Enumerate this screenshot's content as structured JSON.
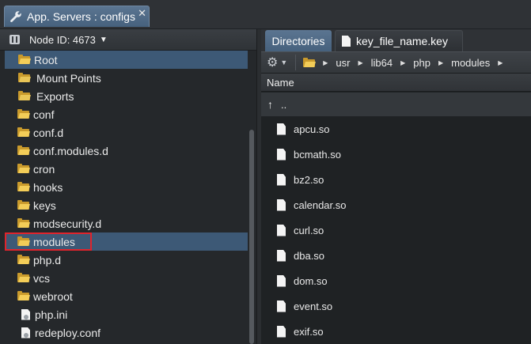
{
  "window": {
    "tab_title": "App. Servers : configs",
    "close_glyph": "✕"
  },
  "left": {
    "node_label": "Node ID: 4673",
    "tree": [
      {
        "label": "Root",
        "icon": "open-folder-icon",
        "selected": true
      },
      {
        "label": "Mount Points",
        "icon": "mount-folder-icon"
      },
      {
        "label": "Exports",
        "icon": "export-folder-icon"
      },
      {
        "label": "conf",
        "icon": "folder-icon"
      },
      {
        "label": "conf.d",
        "icon": "folder-icon"
      },
      {
        "label": "conf.modules.d",
        "icon": "folder-icon"
      },
      {
        "label": "cron",
        "icon": "folder-icon"
      },
      {
        "label": "hooks",
        "icon": "folder-icon"
      },
      {
        "label": "keys",
        "icon": "folder-icon"
      },
      {
        "label": "modsecurity.d",
        "icon": "folder-icon"
      },
      {
        "label": "modules",
        "icon": "folder-icon",
        "selected": true,
        "highlighted": true
      },
      {
        "label": "php.d",
        "icon": "folder-icon"
      },
      {
        "label": "vcs",
        "icon": "folder-icon"
      },
      {
        "label": "webroot",
        "icon": "folder-icon"
      },
      {
        "label": "php.ini",
        "icon": "config-file-icon"
      },
      {
        "label": "redeploy.conf",
        "icon": "config-file-icon"
      }
    ]
  },
  "right": {
    "tabs": [
      {
        "label": "Directories",
        "active": true
      },
      {
        "label": "key_file_name.key",
        "active": false
      }
    ],
    "breadcrumb": [
      "usr",
      "lib64",
      "php",
      "modules"
    ],
    "column_header": "Name",
    "parent_row": {
      "arrow": "↑",
      "label": ".."
    },
    "files": [
      "apcu.so",
      "bcmath.so",
      "bz2.so",
      "calendar.so",
      "curl.so",
      "dba.so",
      "dom.so",
      "event.so",
      "exif.so"
    ]
  },
  "colors": {
    "selection": "#3d5976",
    "highlight_border": "#e0242c",
    "folder": "#f3cd58"
  }
}
